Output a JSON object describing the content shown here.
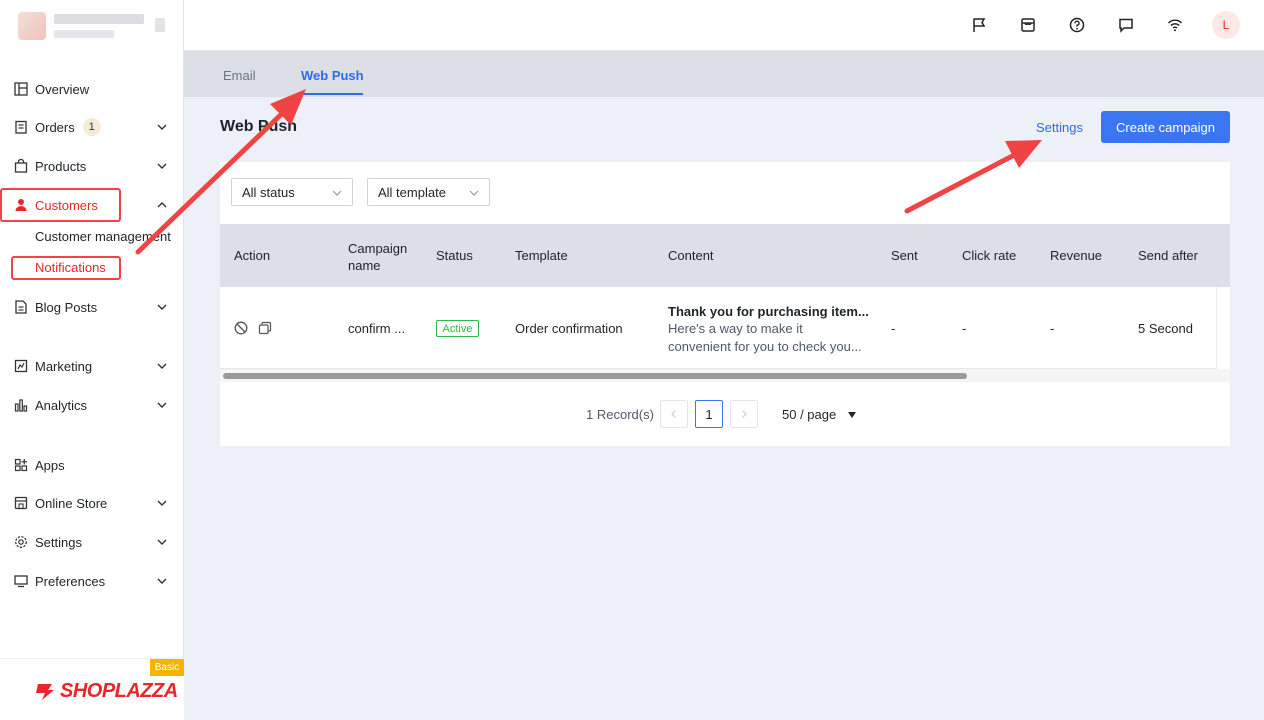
{
  "sidebar": {
    "items": [
      {
        "label": "Overview",
        "icon": "overview-icon"
      },
      {
        "label": "Orders",
        "icon": "orders-icon",
        "badge": "1"
      },
      {
        "label": "Products",
        "icon": "products-icon"
      },
      {
        "label": "Customers",
        "icon": "customers-icon"
      },
      {
        "label": "Blog Posts",
        "icon": "blog-icon"
      },
      {
        "label": "Marketing",
        "icon": "marketing-icon"
      },
      {
        "label": "Analytics",
        "icon": "analytics-icon"
      },
      {
        "label": "Apps",
        "icon": "apps-icon"
      },
      {
        "label": "Online Store",
        "icon": "store-icon"
      },
      {
        "label": "Settings",
        "icon": "gear-icon"
      },
      {
        "label": "Preferences",
        "icon": "monitor-icon"
      }
    ],
    "sub_items": [
      "Customer management",
      "Notifications"
    ],
    "brand": "SHOPLAZZA",
    "plan_tag": "Basic"
  },
  "topbar": {
    "icons": [
      "flag-icon",
      "store-icon",
      "help-icon",
      "chat-icon",
      "wifi-icon"
    ],
    "avatar_initial": "L"
  },
  "tabs": [
    "Email",
    "Web Push"
  ],
  "page": {
    "title": "Web Push",
    "settings_link": "Settings",
    "create_button": "Create campaign"
  },
  "filters": {
    "status": "All status",
    "template": "All template"
  },
  "table": {
    "columns": [
      "Action",
      "Campaign name",
      "Status",
      "Template",
      "Content",
      "Sent",
      "Click rate",
      "Revenue",
      "Send after"
    ],
    "rows": [
      {
        "campaign_name": "confirm ...",
        "status": "Active",
        "template": "Order confirmation",
        "content_title": "Thank you for purchasing item...",
        "content_line1": "Here's a way to make it",
        "content_line2": "convenient for you to check you...",
        "sent": "-",
        "click_rate": "-",
        "revenue": "-",
        "send_after": "5 Second"
      }
    ]
  },
  "pagination": {
    "total": "1 Record(s)",
    "current_page": "1",
    "page_size": "50 / page"
  },
  "colors": {
    "accent": "#2e6be6",
    "brand_red": "#e8262b",
    "active_green": "#2db84d",
    "annotation_red": "#f04444"
  }
}
